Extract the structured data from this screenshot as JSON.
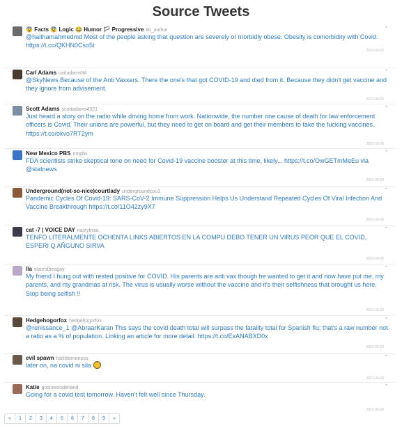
{
  "header": {
    "title": "Source Tweets"
  },
  "tweets": [
    {
      "name": "😨 Facts 😨 Logic 😂 Humor 🏳 Progressive",
      "handle": "kb_author",
      "text": "@haithamahmedmd Most of the people asking that question are severely or morbidly obese. Obesity is comorbidity with Covid. https://t.co/QKHN0Cso5t",
      "date": "2021-09-20",
      "avatar_color": "#6b6b6b"
    },
    {
      "name": "Carl Adams",
      "handle": "carladams94",
      "text": "@SkyNews Because of the Anti Vaxxers. There the one's that got COVID-19 and died from it. Because they didn't get vaccine and they ignore from advisement.",
      "date": "2021-09-20",
      "avatar_color": "#4a3b2f"
    },
    {
      "name": "Scott Adams",
      "handle": "scottadams4321",
      "text": "Just heard a story on the radio while driving home from work. Nationwide, the number one cause of death for law enforcement officers is Covid. Their unions are powerful, but they need to get on board and get their members to take the fucking vaccines. https://t.co/okvo7RT2ym",
      "date": "2021-09-20",
      "avatar_color": "#7d8fa3"
    },
    {
      "name": "New Mexico PBS",
      "handle": "nmpbs",
      "text": "FDA scientists strike skeptical tone on need for Covid-19 vaccine booster at this time, likely... https://t.co/OwGETmMeEu via @statnews",
      "date": "2021-09-20",
      "avatar_color": "#3a76c4"
    },
    {
      "name": "Underground(not-so-nice)courtlady",
      "handle": "undergroundcou1",
      "text": "Pandemic Cycles Of Covid-19: SARS-CoV-2 Immune Suppression Helps Us Understand Repeated Cycles Of Viral Infection And Vaccine Breakthrough https://t.co/11O42zy9X7",
      "date": "2021-09-20",
      "avatar_color": "#8a5a3a"
    },
    {
      "name": "cat -7 | VOICE DAY",
      "handle": "nastybraa",
      "text": "TENFO LITERALMENTE OCHENTA LINKS ABIERTOS EN LA COMPU DEBO TENER UN VIRUS PEOR QUE EL COVID, ESPERI Q AÑGUNO SIRVA",
      "date": "2021-09-20",
      "avatar_color": "#3b3b4a"
    },
    {
      "name": "lla",
      "handle": "slatetdbeagay",
      "text": "My friend I hung out with rested positive for COVID. His parents are anti vax though he wanted to get it and now have put me, my parents, and my grandmas at risk. The virus is usually worse without the vaccine and it's their selfishness that brought us here. Stop being selfish !!",
      "date": "2021-09-20",
      "avatar_color": "#b9a9c9"
    },
    {
      "name": "Hedgehogorfox",
      "handle": "hedgehogorfox",
      "text": "@renissance_1 @AbraarKaran This says the covid death total will surpass the fatality total for Spanish flu; that's a raw number not a ratio as a % of population. Linking an article for more detail. https://t.co/ExANABXD0x",
      "date": "2021-09-20",
      "avatar_color": "#5a4a3a"
    },
    {
      "name": "evil spawn",
      "handle": "hislildemoness",
      "text": "later on, na covid ni sila",
      "date": "2021-09-20",
      "avatar_color": "#6a5a4a"
    },
    {
      "name": "Katie",
      "handle": "gosinwonderland",
      "text": "Going for a covid test tomorrow. Haven't felt well since Thursday.",
      "date": "2021-09-20",
      "avatar_color": "#9a6a5a"
    }
  ],
  "pagination": [
    "«",
    "1",
    "2",
    "3",
    "4",
    "5",
    "6",
    "7",
    "8",
    "9",
    "»"
  ]
}
